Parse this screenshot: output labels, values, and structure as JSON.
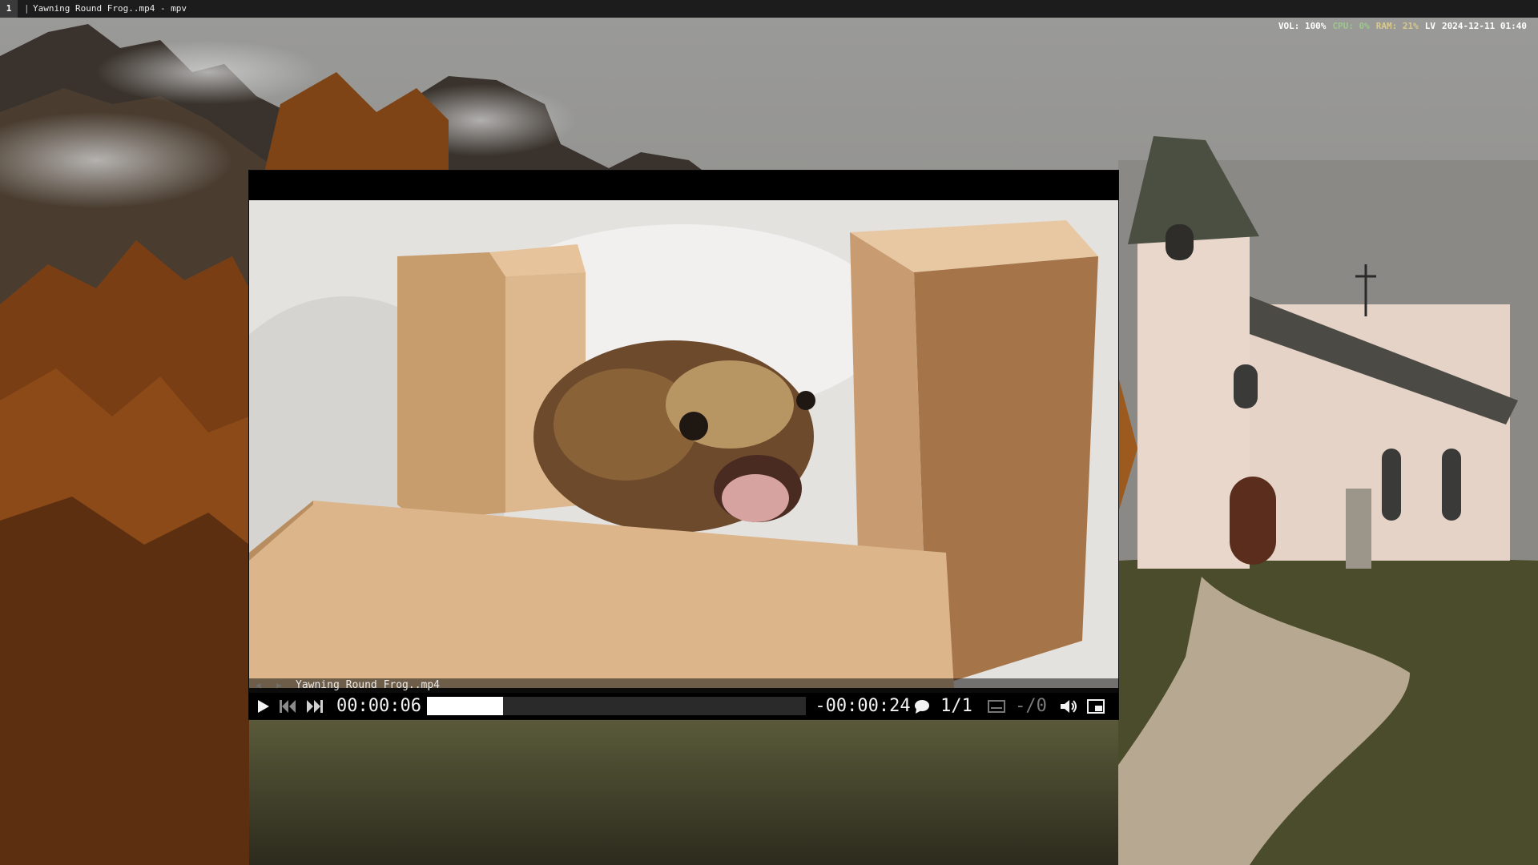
{
  "bar": {
    "workspace": "1",
    "separator": "|",
    "window_title": "Yawning Round Frog..mp4 - mpv",
    "vol": "VOL: 100%",
    "cpu": "CPU: 0%",
    "ram": "RAM: 21%",
    "lang": "LV",
    "datetime": "2024-12-11 01:40",
    "colors": {
      "vol": "#ffffff",
      "cpu": "#9cc98a",
      "ram": "#d9c98b",
      "lang": "#ffffff",
      "datetime": "#ffffff"
    }
  },
  "player": {
    "filename": "Yawning Round Frog..mp4",
    "elapsed": "00:00:06",
    "remaining": "-00:00:24",
    "progress": 0.2,
    "subtitle_track": "1/1",
    "audio_track": "-/0",
    "icons": {
      "play": "play-icon",
      "prev": "skip-back-icon",
      "next": "skip-forward-icon",
      "chat": "chat-bubble-icon",
      "sub": "subtitle-icon",
      "volume": "volume-icon",
      "fullscreen": "fullscreen-icon",
      "playlist_prev": "playlist-prev-icon",
      "playlist_next": "playlist-next-icon"
    }
  }
}
